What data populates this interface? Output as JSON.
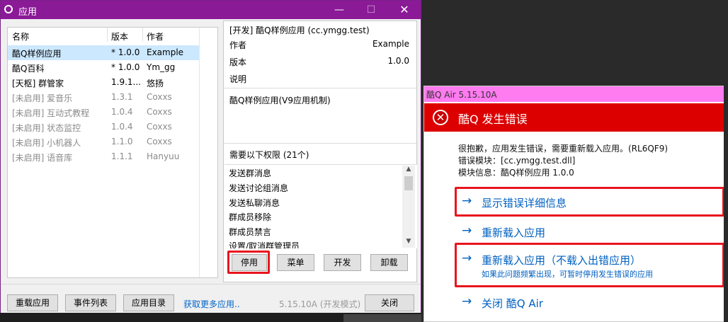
{
  "window": {
    "title": "应用",
    "minimize": "—",
    "maximize": "☐",
    "close": "✕"
  },
  "list": {
    "headers": [
      "名称",
      "版本",
      "作者"
    ],
    "rows": [
      {
        "name": "酷Q样例应用",
        "version": "* 1.0.0",
        "author": "Example"
      },
      {
        "name": "酷Q百科",
        "version": "* 1.0.0",
        "author": "Ym_gg"
      },
      {
        "name": "[天枢] 群管家",
        "version": "1.9.1...",
        "author": "悠扬"
      },
      {
        "name": "[未启用] 爱音乐",
        "version": "1.3.1",
        "author": "Coxxs"
      },
      {
        "name": "[未启用] 互动式教程",
        "version": "1.0.4",
        "author": "Coxxs"
      },
      {
        "name": "[未启用] 状态监控",
        "version": "1.0.4",
        "author": "Coxxs"
      },
      {
        "name": "[未启用] 小机器人",
        "version": "1.1.0",
        "author": "Coxxs"
      },
      {
        "name": "[未启用] 语音库",
        "version": "1.1.1",
        "author": "Hanyuu"
      }
    ]
  },
  "detail": {
    "title": "[开发] 酷Q样例应用 (cc.ymgg.test)",
    "author_label": "作者",
    "author_value": "Example",
    "version_label": "版本",
    "version_value": "1.0.0",
    "desc_label": "说明",
    "description": "酷Q样例应用(V9应用机制)",
    "perm_header": "需要以下权限 (21个)",
    "permissions": [
      "发送群消息",
      "发送讨论组消息",
      "发送私聊消息",
      "群成员移除",
      "群成员禁言",
      "设置/取消群管理员"
    ],
    "buttons": {
      "disable": "停用",
      "menu": "菜单",
      "dev": "开发",
      "uninstall": "卸载"
    }
  },
  "footer": {
    "reload": "重载应用",
    "events": "事件列表",
    "app_dir": "应用目录",
    "more_link": "获取更多应用..",
    "version_text": "5.15.10A (开发模式)",
    "close": "关闭"
  },
  "error_dialog": {
    "title": "酷Q Air 5.15.10A",
    "heading": "酷Q 发生错误",
    "message_line1": "很抱歉，应用发生错误，需要重新载入应用。(RL6QF9)",
    "message_line2": "错误模块：[cc.ymgg.test.dll]",
    "message_line3": "模块信息：酷Q样例应用 1.0.0",
    "options": [
      {
        "label": "显示错误详细信息",
        "sub": ""
      },
      {
        "label": "重新载入应用",
        "sub": ""
      },
      {
        "label": "重新载入应用（不载入出错应用）",
        "sub": "如果此问题频繁出现，可暂时停用发生错误的应用"
      },
      {
        "label": "关闭 酷Q Air",
        "sub": ""
      }
    ],
    "arrow": "→",
    "close_glyph": "✕"
  },
  "colors": {
    "titlebar": "#8b1a97",
    "error_header": "#dd0000",
    "highlight": "#e8151e",
    "link": "#0060c0"
  }
}
